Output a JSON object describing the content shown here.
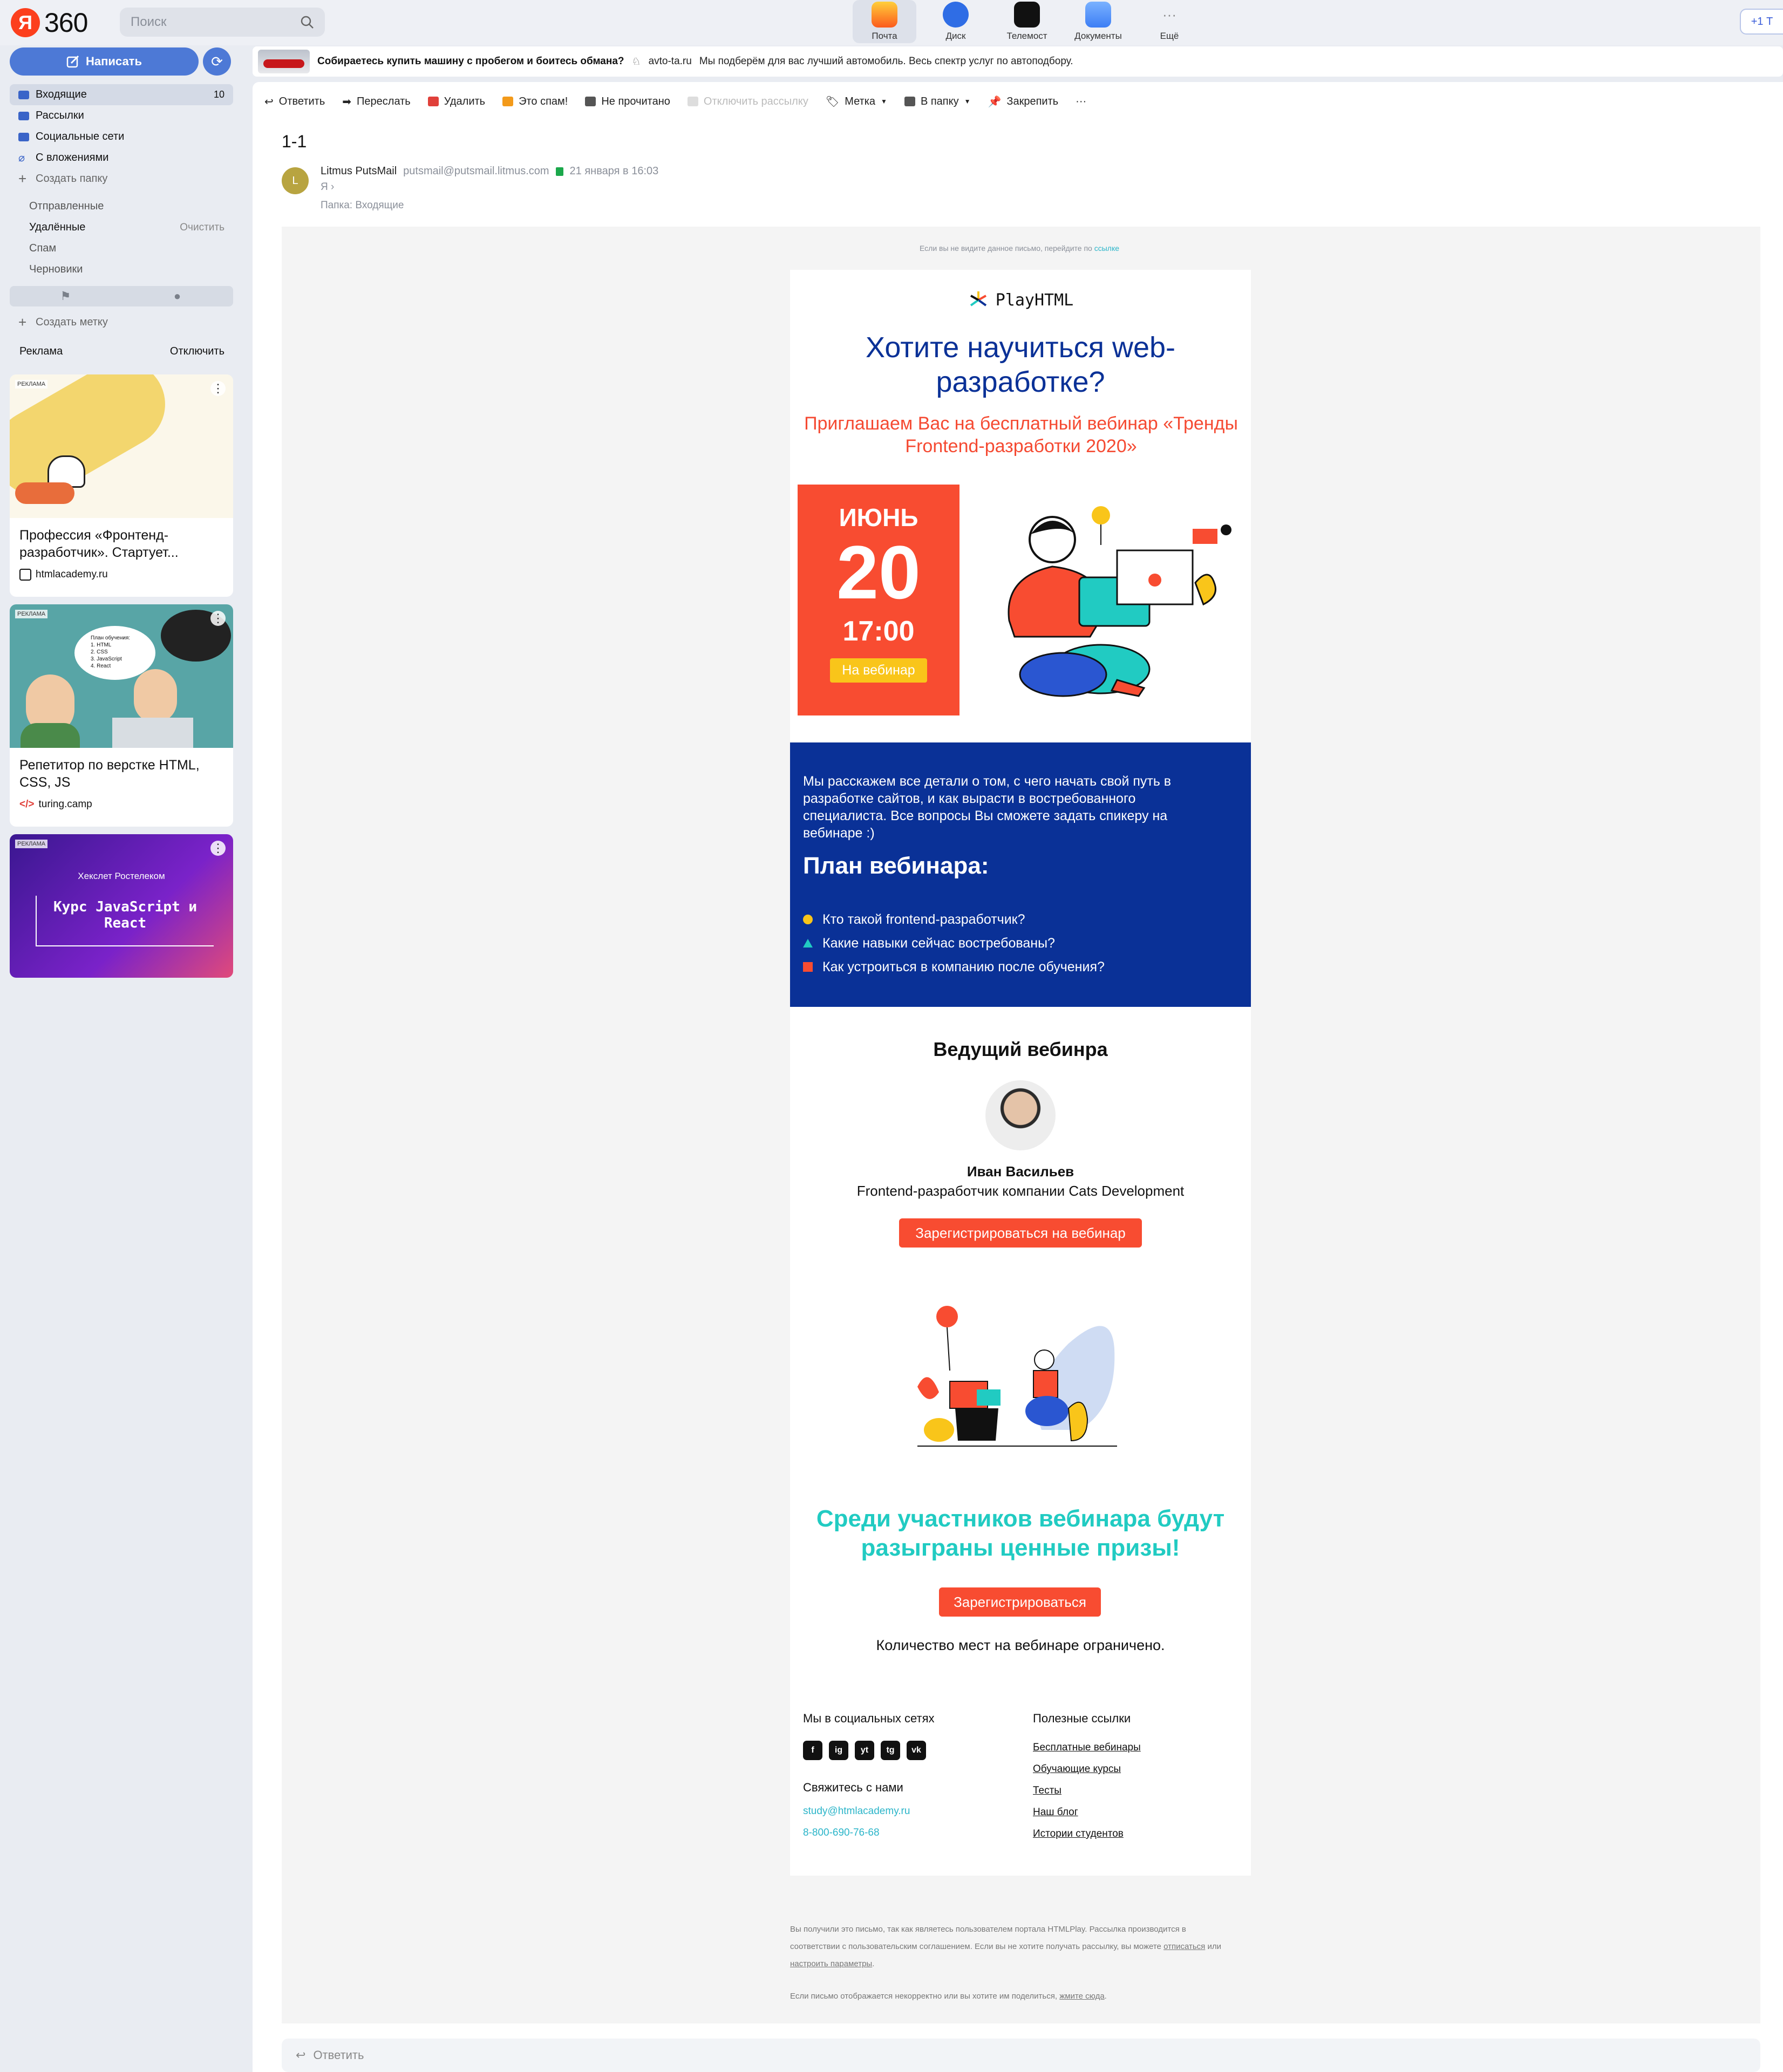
{
  "topbar": {
    "logo_text": "360",
    "search_placeholder": "Поиск",
    "services": [
      {
        "label": "Почта",
        "color": "#ff9a1f",
        "active": true
      },
      {
        "label": "Диск",
        "color": "#2f6de5"
      },
      {
        "label": "Телемост",
        "color": "#111111"
      },
      {
        "label": "Документы",
        "color": "#3d7ef5"
      },
      {
        "label": "Ещё",
        "color": "#dfe2e9"
      }
    ],
    "plus_label": "+1 Т"
  },
  "banner": {
    "title": "Собираетесь купить машину с пробегом и боитесь обмана?",
    "site": "avto-ta.ru",
    "text": "Мы подберём для вас лучший автомобиль. Весь спектр услуг по автоподбору."
  },
  "sidebar": {
    "compose_label": "Написать",
    "folders": [
      {
        "label": "Входящие",
        "count": "10",
        "active": true
      },
      {
        "label": "Рассылки"
      },
      {
        "label": "Социальные сети"
      },
      {
        "label": "С вложениями"
      }
    ],
    "create_folder": "Создать папку",
    "system_folders": [
      {
        "label": "Отправленные"
      },
      {
        "label": "Удалённые",
        "action": "Очистить"
      },
      {
        "label": "Спам"
      },
      {
        "label": "Черновики"
      }
    ],
    "create_label": "Создать метку",
    "ads_label": "Реклама",
    "ads_disable": "Отключить",
    "ads": [
      {
        "tag": "РЕКЛАМА",
        "title": "Профессия «Фронтенд-разработчик». Стартует...",
        "source": "htmlacademy.ru"
      },
      {
        "tag": "РЕКЛАМА",
        "title": "Репетитор по верстке HTML, CSS, JS",
        "source": "turing.camp",
        "plan_title": "План обучения:",
        "plan": [
          "1. HTML",
          "2. CSS",
          "3. JavaScript",
          "4. React"
        ]
      },
      {
        "tag": "РЕКЛАМА",
        "brands": "Хекслет  Ростелеком",
        "headline": "Курс JavaScript и React"
      }
    ]
  },
  "toolbar": {
    "items": [
      "Ответить",
      "Переслать",
      "Удалить",
      "Это спам!",
      "Не прочитано",
      "Отключить рассылку",
      "Метка",
      "В папку",
      "Закрепить",
      "···"
    ]
  },
  "message": {
    "subject": "1-1",
    "avatar_letter": "L",
    "sender_name": "Litmus PutsMail",
    "sender_email": "putsmail@putsmail.litmus.com",
    "date": "21 января в 16:03",
    "to": "Я",
    "folder": "Папка:  Входящие"
  },
  "email": {
    "preheader_text": "Если вы не видите данное письмо, перейдите по",
    "preheader_link": "ссылке",
    "brand": "PlayHTML",
    "headline": "Хотите научиться web-разработке?",
    "subheadline": "Приглашаем Вас на бесплатный вебинар «Тренды Frontend-разработки 2020»",
    "date_month": "ИЮНЬ",
    "date_day": "20",
    "date_time": "17:00",
    "date_button": "На  вебинар",
    "intro": "Мы расскажем все детали о том, с чего начать свой путь в разработке сайтов, и как вырасти в востребованного специалиста. Все вопросы Вы сможете задать спикеру на вебинаре :)",
    "plan_title": "План вебинара:",
    "plan_items": [
      {
        "text": "Кто такой frontend-разработчик?",
        "color": "#f9c51a",
        "shape": "circle"
      },
      {
        "text": "Какие навыки сейчас востребованы?",
        "color": "#21cbc2",
        "shape": "triangle"
      },
      {
        "text": "Как устроиться в компанию после обучения?",
        "color": "#f84c31",
        "shape": "square"
      }
    ],
    "speaker_title": "Ведущий вебинра",
    "speaker_name": "Иван Васильев",
    "speaker_role": "Frontend-разработчик компании Cats Development",
    "register_button": "Зарегистрироваться на вебинар",
    "prize_text": "Среди участников вебинара будут разыграны ценные призы!",
    "register_button_2": "Зарегистрироваться",
    "limit_text": "Количество мест на вебинаре ограничено.",
    "social_title": "Мы в социальных сетях",
    "socials": [
      "f",
      "ig",
      "yt",
      "tg",
      "vk"
    ],
    "contact_title": "Свяжитесь с нами",
    "contact_email": "study@htmlacademy.ru",
    "contact_phone": "8-800-690-76-68",
    "links_title": "Полезные ссылки",
    "links": [
      "Бесплатные вебинары",
      "Обучающие курсы",
      "Тесты",
      "Наш блог",
      "Истории студентов"
    ],
    "legal_1": "Вы получили это письмо, так как являетесь пользователем портала HTMLPlay. Рассылка производится в соответствии с пользовательским соглашением. Если вы не хотите получать рассылку, вы можете",
    "legal_unsub": "отписаться",
    "legal_or": "или",
    "legal_settings": "настроить параметры",
    "legal_2": "Если письмо отображается некорректно или вы хотите им поделиться,",
    "legal_here": "жмите сюда"
  },
  "reply_bar": {
    "label": "Ответить"
  },
  "colors": {
    "accent": "#4d79d6",
    "email_blue": "#0a3197",
    "email_red": "#f84c31",
    "email_teal": "#21cbc2"
  }
}
